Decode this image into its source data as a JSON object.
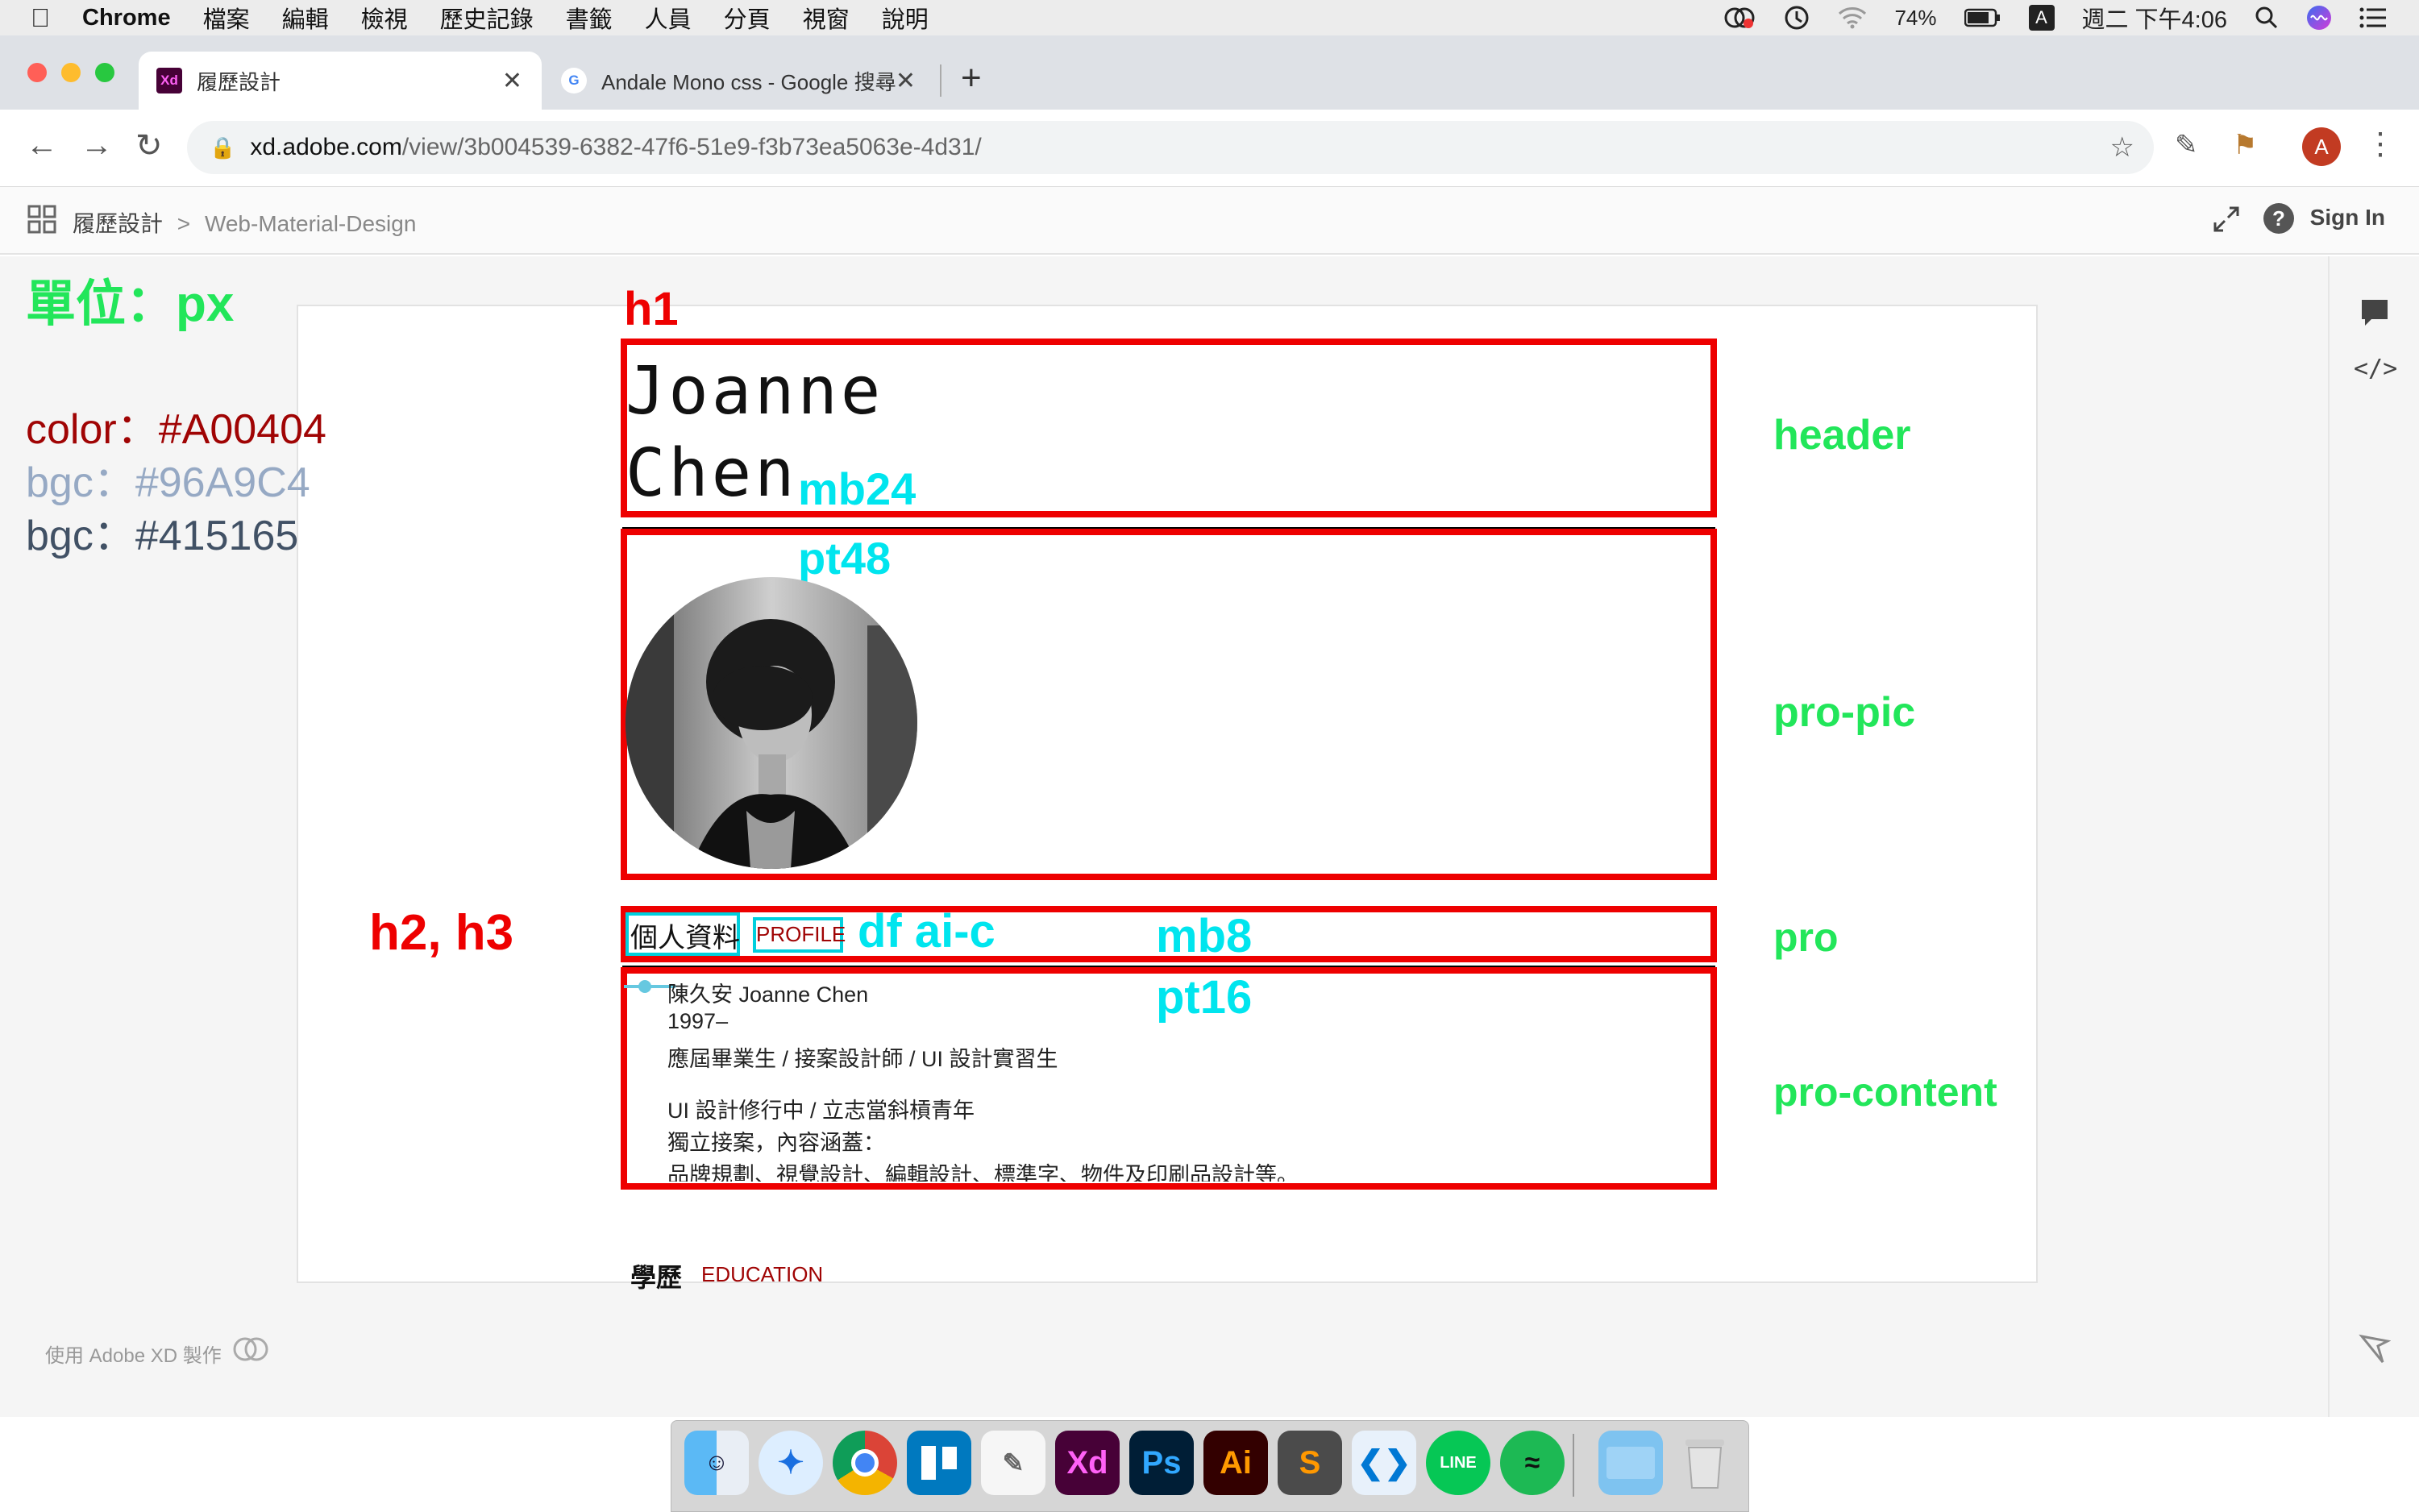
{
  "menubar": {
    "app_name": "Chrome",
    "items": [
      "檔案",
      "編輯",
      "檢視",
      "歷史記錄",
      "書籤",
      "人員",
      "分頁",
      "視窗",
      "說明"
    ],
    "battery": "74%",
    "input_method": "A",
    "clock": "週二 下午4:06"
  },
  "tabs": [
    {
      "title": "履歷設計",
      "favicon": "Xd"
    },
    {
      "title": "Andale Mono css - Google 搜尋",
      "favicon": "G"
    }
  ],
  "address": {
    "host": "xd.adobe.com",
    "path": "/view/3b004539-6382-47f6-51e9-f3b73ea5063e-4d31/"
  },
  "profile_initial": "A",
  "xd_bar": {
    "project": "履歷設計",
    "separator": ">",
    "page": "Web-Material-Design",
    "sign_in": "Sign In"
  },
  "notes": {
    "unit": "單位：px",
    "color": "color：#A00404",
    "bgc1": "bgc：#96A9C4",
    "bgc2": "bgc：#415165"
  },
  "labels": {
    "h1": "h1",
    "mb24": "mb24",
    "pt48": "pt48",
    "h2h3": "h2, h3",
    "dfaic": "df  ai-c",
    "mb8": "mb8",
    "pt16": "pt16",
    "header": "header",
    "pro_pic": "pro-pic",
    "pro": "pro",
    "pro_content": "pro-content"
  },
  "resume": {
    "name_line1": "Joanne",
    "name_line2": "Chen",
    "section_title": "個人資料",
    "section_title_en": "PROFILE",
    "lines": [
      "陳久安 Joanne Chen",
      "1997–",
      "應屆畢業生 / 接案設計師 / UI 設計實習生",
      "UI 設計修行中 / 立志當斜槓青年",
      "獨立接案，內容涵蓋：",
      "品牌規劃、視覺設計、編輯設計、標準字、物件及印刷品設計等。"
    ],
    "next_section": "學歷",
    "next_section_en": "EDUCATION"
  },
  "footer_note": "使用 Adobe XD 製作",
  "dock_apps": [
    "Finder",
    "Safari",
    "Chrome",
    "Trello",
    "TextEdit",
    "Xd",
    "Ps",
    "Ai",
    "Sublime",
    "VS Code",
    "LINE",
    "Spotify",
    "Folder",
    "Trash"
  ],
  "colors": {
    "accent_red": "#A00404",
    "bgc_light": "#96A9C4",
    "bgc_dark": "#415165",
    "annotation_green": "#22e65a",
    "annotation_cyan": "#00e5ee",
    "annotation_red": "#ee0000"
  }
}
